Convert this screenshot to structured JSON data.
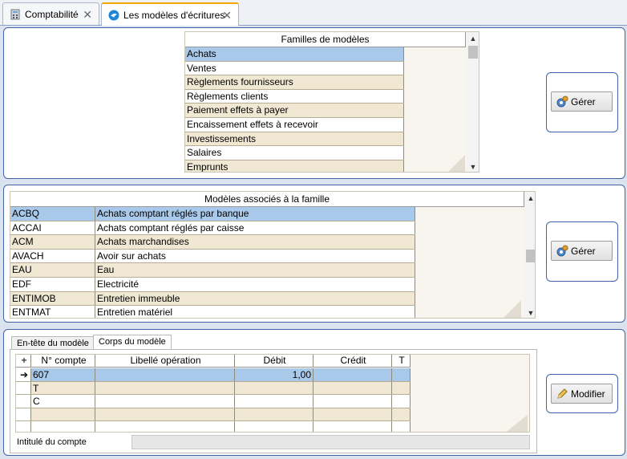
{
  "tabs": [
    {
      "label": "Comptabilité",
      "icon": "calculator-icon"
    },
    {
      "label": "Les modèles d'écritures",
      "icon": "bird-icon"
    }
  ],
  "families": {
    "header": "Familles de modèles",
    "rows": [
      "Achats",
      "Ventes",
      "Règlements fournisseurs",
      "Règlements clients",
      "Paiement effets à payer",
      "Encaissement effets à recevoir",
      "Investissements",
      "Salaires",
      "Emprunts"
    ],
    "selected_index": 0,
    "button": "Gérer"
  },
  "models": {
    "header": "Modèles associés à la famille",
    "rows": [
      {
        "code": "ACBQ",
        "label": "Achats comptant réglés par banque"
      },
      {
        "code": "ACCAI",
        "label": "Achats comptant réglés par caisse"
      },
      {
        "code": "ACM",
        "label": "Achats marchandises"
      },
      {
        "code": "AVACH",
        "label": "Avoir sur achats"
      },
      {
        "code": "EAU",
        "label": "Eau"
      },
      {
        "code": "EDF",
        "label": "Electricité"
      },
      {
        "code": "ENTIMOB",
        "label": "Entretien immeuble"
      },
      {
        "code": "ENTMAT",
        "label": "Entretien matériel"
      }
    ],
    "selected_index": 0,
    "button": "Gérer"
  },
  "body": {
    "subtabs": [
      "En-tête du modèle",
      "Corps du modèle"
    ],
    "active_subtab": 1,
    "columns": [
      "N° compte",
      "Libellé opération",
      "Débit",
      "Crédit",
      "T"
    ],
    "add_symbol": "+",
    "rows": [
      {
        "marker": "➔",
        "compte": "607",
        "libelle": "",
        "debit": "1,00",
        "credit": "",
        "t": ""
      },
      {
        "marker": "",
        "compte": "T",
        "libelle": "",
        "debit": "",
        "credit": "",
        "t": ""
      },
      {
        "marker": "",
        "compte": "C",
        "libelle": "",
        "debit": "",
        "credit": "",
        "t": ""
      },
      {
        "marker": "",
        "compte": "",
        "libelle": "",
        "debit": "",
        "credit": "",
        "t": ""
      },
      {
        "marker": "",
        "compte": "",
        "libelle": "",
        "debit": "",
        "credit": "",
        "t": ""
      }
    ],
    "footer_label": "Intitulé du compte",
    "footer_value": "",
    "button": "Modifier"
  }
}
